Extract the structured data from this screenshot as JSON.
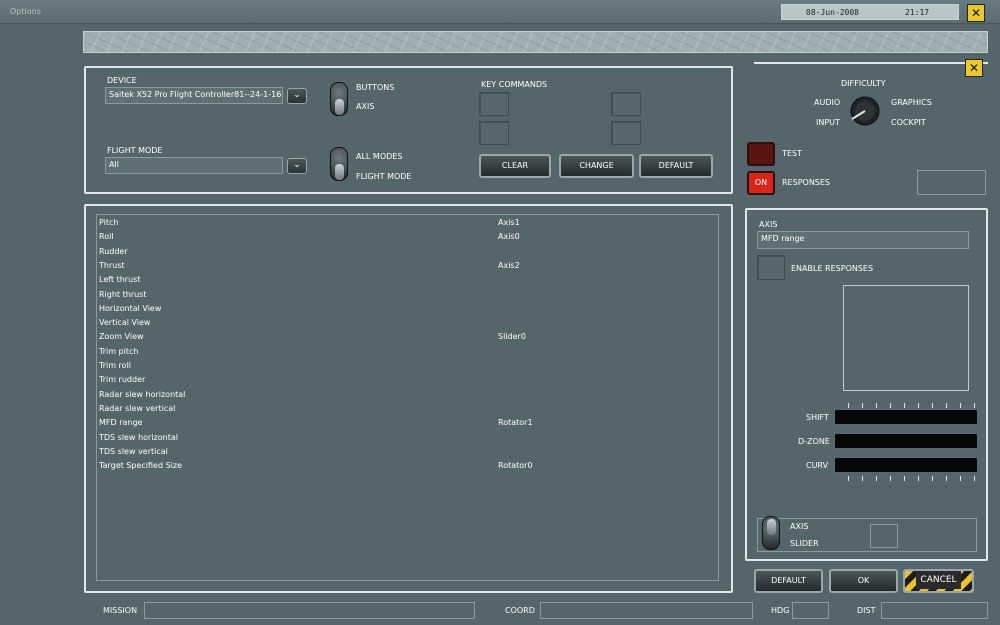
{
  "window": {
    "title": "Options",
    "date": "08-Jun-2008",
    "time": "21:17",
    "close_glyph": "✕"
  },
  "device_panel": {
    "device_label": "DEVICE",
    "device_value": "Saitek X52 Pro Flight Controller81--24-1-16(",
    "flight_mode_label": "FLIGHT MODE",
    "flight_mode_value": "All",
    "toggle1_top": "BUTTONS",
    "toggle1_bottom": "AXIS",
    "toggle2_top": "ALL MODES",
    "toggle2_bottom": "FLIGHT MODE",
    "key_commands_label": "KEY COMMANDS",
    "clear_label": "CLEAR",
    "change_label": "CHANGE",
    "default_label": "DEFAULT",
    "dropdown_glyph": "⌄"
  },
  "axis_list": [
    {
      "name": "Pitch",
      "value": "Axis1"
    },
    {
      "name": "Roll",
      "value": "Axis0"
    },
    {
      "name": "Rudder",
      "value": ""
    },
    {
      "name": "Thrust",
      "value": "Axis2"
    },
    {
      "name": "Left thrust",
      "value": ""
    },
    {
      "name": "Right thrust",
      "value": ""
    },
    {
      "name": "Horizontal View",
      "value": ""
    },
    {
      "name": "Vertical View",
      "value": ""
    },
    {
      "name": "Zoom View",
      "value": "Slider0"
    },
    {
      "name": "Trim pitch",
      "value": ""
    },
    {
      "name": "Trim roll",
      "value": ""
    },
    {
      "name": "Trim rudder",
      "value": ""
    },
    {
      "name": "Radar slew horizontal",
      "value": ""
    },
    {
      "name": "Radar slew vertical",
      "value": ""
    },
    {
      "name": "MFD range",
      "value": "Rotator1"
    },
    {
      "name": "TDS slew horizontal",
      "value": ""
    },
    {
      "name": "TDS slew vertical",
      "value": ""
    },
    {
      "name": "Target Specified Size",
      "value": "Rotator0"
    }
  ],
  "right_panel": {
    "difficulty": "DIFFICULTY",
    "audio": "AUDIO",
    "graphics": "GRAPHICS",
    "input": "INPUT",
    "cockpit": "COCKPIT",
    "test_label": "TEST",
    "on_label": "ON",
    "responses_label": "RESPONSES",
    "axis_label": "AXIS",
    "axis_value": "MFD range",
    "enable_responses": "ENABLE RESPONSES",
    "shift": "SHIFT",
    "dzone": "D-ZONE",
    "curv": "CURV",
    "toggle3_top": "AXIS",
    "toggle3_bottom": "SLIDER"
  },
  "footer": {
    "default_label": "DEFAULT",
    "ok_label": "OK",
    "cancel_label": "CANCEL",
    "mission": "MISSION",
    "coord": "COORD",
    "hdg": "HDG",
    "dist": "DIST"
  },
  "colors": {
    "background": "#54656b",
    "accent_yellow": "#e8c92c",
    "led_red": "#d9261c",
    "led_dark": "#5a1512"
  }
}
